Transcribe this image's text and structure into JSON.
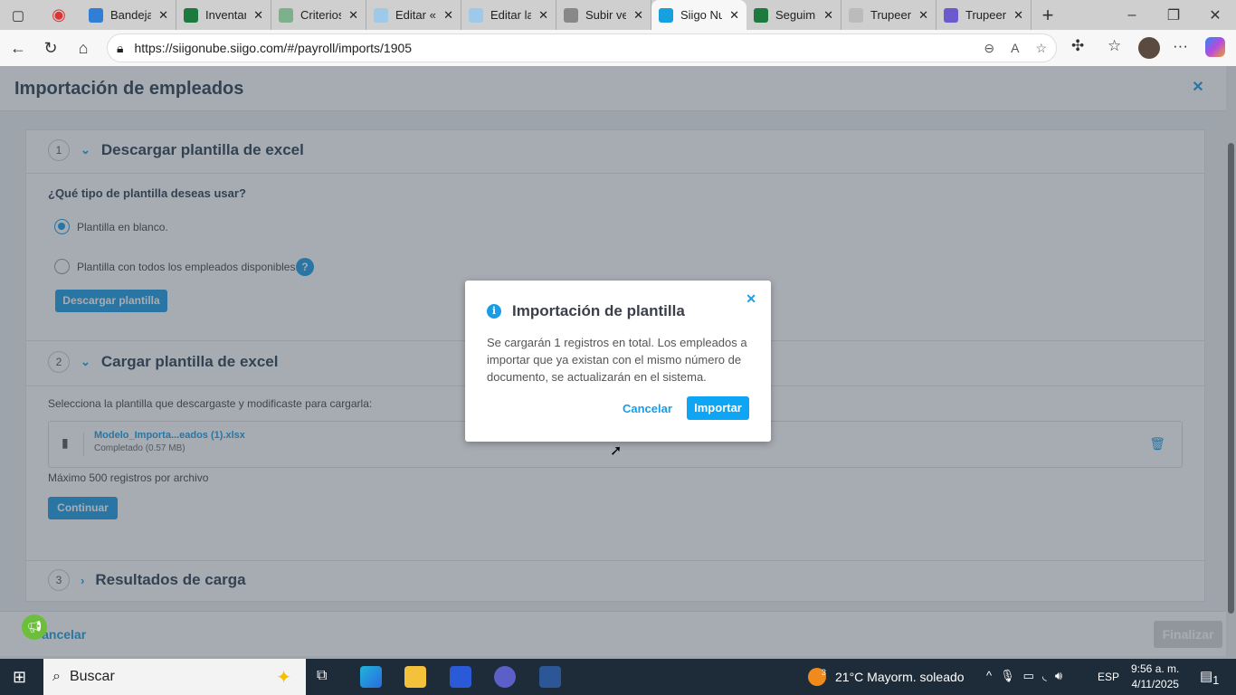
{
  "browser": {
    "tabs": [
      {
        "label": "Bandeja",
        "color": "#2f7fd6"
      },
      {
        "label": "Inventar",
        "color": "#1d7a3e"
      },
      {
        "label": "Criterios",
        "color": "#7fb08d"
      },
      {
        "label": "Editar «S",
        "color": "#9fc9e8"
      },
      {
        "label": "Editar la",
        "color": "#9fc9e8"
      },
      {
        "label": "Subir ve",
        "color": "#888"
      },
      {
        "label": "Siigo Nu",
        "color": "#16a0e0"
      },
      {
        "label": "Seguimi",
        "color": "#1d7a3e"
      },
      {
        "label": "Trupeer.",
        "color": "#bbb"
      },
      {
        "label": "Trupeer.",
        "color": "#6a5acd"
      }
    ],
    "active_tab": 6,
    "url": "https://siigonube.siigo.com/#/payroll/imports/1905"
  },
  "page": {
    "title": "Importación de empleados",
    "section1": {
      "num": "1",
      "title": "Descargar plantilla de excel",
      "question": "¿Qué tipo de plantilla deseas usar?",
      "option1": "Plantilla en blanco.",
      "option2": "Plantilla con todos los empleados disponibles.",
      "help": "?",
      "button": "Descargar plantilla"
    },
    "section2": {
      "num": "2",
      "title": "Cargar plantilla de excel",
      "instruction": "Selecciona la plantilla que descargaste y modificaste para cargarla:",
      "file_name": "Modelo_Importa...eados (1).xlsx",
      "file_status": "Completado (0.57 MB)",
      "max": "Máximo 500 registros por archivo",
      "button": "Continuar"
    },
    "section3": {
      "num": "3",
      "title": "Resultados de carga"
    },
    "footer": {
      "cancel": "Cancelar",
      "finish": "Finalizar"
    }
  },
  "modal": {
    "title": "Importación de plantilla",
    "body": "Se cargarán 1 registros en total. Los empleados a importar que ya existan con el mismo número de documento, se actualizarán en el sistema.",
    "cancel": "Cancelar",
    "confirm": "Importar"
  },
  "taskbar": {
    "search": "Buscar",
    "weather": "21°C  Mayorm. soleado",
    "weather_badge": "3",
    "lang": "ESP",
    "time": "9:56 a. m.",
    "date": "4/11/2025",
    "notif": "1"
  }
}
